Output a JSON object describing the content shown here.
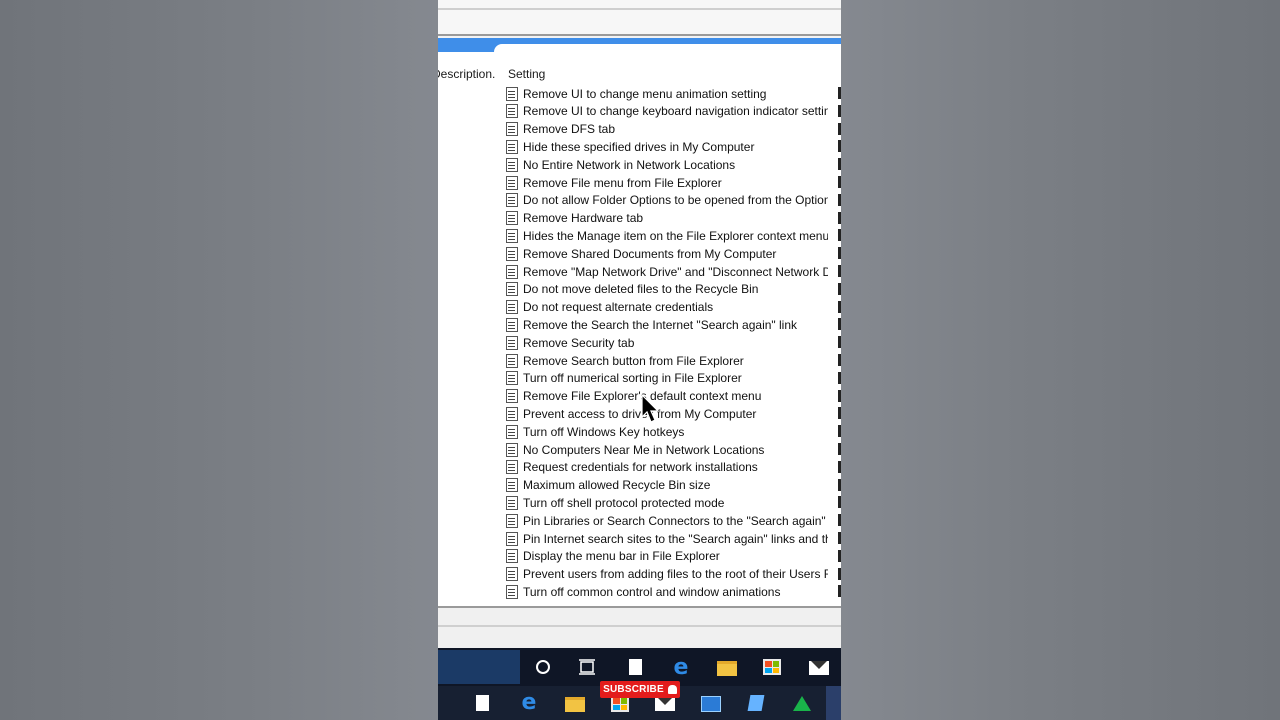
{
  "columns": {
    "description": "Description.",
    "setting": "Setting"
  },
  "settings": [
    "Remove UI to change menu animation setting",
    "Remove UI to change keyboard navigation indicator setting",
    "Remove DFS tab",
    "Hide these specified drives in My Computer",
    "No Entire Network in Network Locations",
    "Remove File menu from File Explorer",
    "Do not allow Folder Options to be opened from the Options...",
    "Remove Hardware tab",
    "Hides the Manage item on the File Explorer context menu",
    "Remove Shared Documents from My Computer",
    "Remove \"Map Network Drive\" and \"Disconnect Network Dri...",
    "Do not move deleted files to the Recycle Bin",
    "Do not request alternate credentials",
    "Remove the Search the Internet \"Search again\" link",
    "Remove Security tab",
    "Remove Search button from File Explorer",
    "Turn off numerical sorting in File Explorer",
    "Remove File Explorer's default context menu",
    "Prevent access to drives from My Computer",
    "Turn off Windows Key hotkeys",
    "No Computers Near Me in Network Locations",
    "Request credentials for network installations",
    "Maximum allowed Recycle Bin size",
    "Turn off shell protocol protected mode",
    "Pin Libraries or Search Connectors to the \"Search again\" link...",
    "Pin Internet search sites to the \"Search again\" links and the S...",
    "Display the menu bar in File Explorer",
    "Prevent users from adding files to the root of their Users File...",
    "Turn off common control and window animations"
  ],
  "overlay": {
    "subscribe_label": "SUBSCRIBE"
  },
  "taskbar": {
    "top_icons": [
      "cortana-icon",
      "task-view-icon",
      "document-icon",
      "edge-icon",
      "file-explorer-icon",
      "store-icon",
      "mail-icon"
    ],
    "bottom_icons": [
      "document-icon",
      "edge-icon",
      "file-explorer-icon",
      "store-icon",
      "paint-icon",
      "remote-desktop-icon",
      "notepad-icon",
      "app-triangle-icon"
    ]
  },
  "colors": {
    "accent_blue": "#3f8ee9",
    "taskbar": "#0f1626",
    "subscribe_red": "#e31c1c"
  }
}
